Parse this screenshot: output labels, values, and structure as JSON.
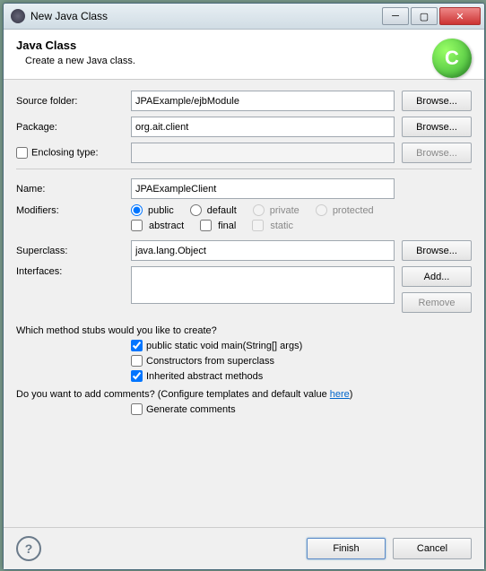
{
  "window": {
    "title": "New Java Class"
  },
  "header": {
    "title": "Java Class",
    "subtitle": "Create a new Java class.",
    "icon_letter": "C"
  },
  "fields": {
    "source_folder_label": "Source folder:",
    "source_folder": "JPAExample/ejbModule",
    "package_label": "Package:",
    "package": "org.ait.client",
    "enclosing_label": "Enclosing type:",
    "enclosing": "",
    "name_label": "Name:",
    "name": "JPAExampleClient",
    "modifiers_label": "Modifiers:",
    "superclass_label": "Superclass:",
    "superclass": "java.lang.Object",
    "interfaces_label": "Interfaces:"
  },
  "modifiers": {
    "public": "public",
    "default": "default",
    "private": "private",
    "protected": "protected",
    "abstract": "abstract",
    "final": "final",
    "static": "static"
  },
  "stubs": {
    "question": "Which method stubs would you like to create?",
    "main": "public static void main(String[] args)",
    "constructors": "Constructors from superclass",
    "inherited": "Inherited abstract methods"
  },
  "comments": {
    "question_a": "Do you want to add comments? (Configure templates and default value ",
    "link": "here",
    "question_b": ")",
    "generate": "Generate comments"
  },
  "buttons": {
    "browse": "Browse...",
    "add": "Add...",
    "remove": "Remove",
    "finish": "Finish",
    "cancel": "Cancel"
  }
}
